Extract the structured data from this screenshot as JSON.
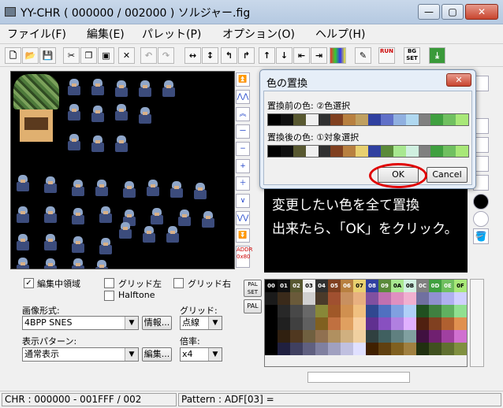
{
  "window": {
    "title": "YY-CHR ( 000000 / 002000 ) ソルジャー.fig",
    "min_glyph": "—",
    "max_glyph": "▢",
    "close_glyph": "✕"
  },
  "menu": [
    "ファイル(F)",
    "編集(E)",
    "パレット(P)",
    "オプション(O)",
    "ヘルプ(H)"
  ],
  "toolbar_icons": [
    "new-icon",
    "open-icon",
    "save-icon",
    "cut-icon",
    "copy-icon",
    "paste-icon",
    "delete-icon",
    "undo-icon",
    "redo-icon",
    "flip-horizontal-icon",
    "flip-vertical-icon",
    "rotate-left-icon",
    "rotate-right-icon",
    "shift-up-icon",
    "shift-down-icon",
    "shift-left-icon",
    "shift-right-icon",
    "palette-icon",
    "edit-icon",
    "run-icon",
    "bg-set-icon",
    "export-icon"
  ],
  "toolbar": {
    "run_label": "RUN",
    "bgset_label": "BG SET"
  },
  "side_buttons": [
    "⏫",
    "⋀⋀",
    "︽",
    "ー",
    "−",
    "+",
    "＋",
    "∨",
    "⋁⋁",
    "⏬"
  ],
  "addr_label": "ADDR 0x80",
  "dialog": {
    "title": "色の置換",
    "before_label": "置換前の色: ②色選択",
    "after_label": "置換後の色: ①対象選択",
    "ok": "OK",
    "cancel": "Cancel",
    "before_colors": [
      "#000000",
      "#101010",
      "#585830",
      "#f0f0f0",
      "#303030",
      "#804020",
      "#b88040",
      "#c0a060",
      "#3040a0",
      "#6070c8",
      "#90b0e0",
      "#b0d8f0",
      "#808080",
      "#40a040",
      "#70c060",
      "#a8e878"
    ],
    "after_colors": [
      "#000000",
      "#101010",
      "#585830",
      "#f0f0f0",
      "#303030",
      "#804020",
      "#b88040",
      "#e8d070",
      "#3040a0",
      "#5a8a3a",
      "#a8e890",
      "#d0f0e0",
      "#808080",
      "#40a040",
      "#70c060",
      "#a8e878"
    ]
  },
  "instruction": {
    "line1": "変更したい色を全て置換",
    "line2": "出来たら、「OK」をクリック。"
  },
  "palette_labels": {
    "pal_set": "PAL SET",
    "pal": "PAL"
  },
  "palette_header": [
    "00",
    "01",
    "02",
    "03",
    "04",
    "05",
    "06",
    "07",
    "08",
    "09",
    "0A",
    "0B",
    "0C",
    "0D",
    "0E",
    "0F"
  ],
  "palette_rows": [
    [
      "#000000",
      "#101010",
      "#585830",
      "#f0f0f0",
      "#303030",
      "#804020",
      "#b88040",
      "#e8d070",
      "#3040a0",
      "#5a8a3a",
      "#a8e890",
      "#d0f0e0",
      "#808080",
      "#40a040",
      "#70c060",
      "#a8e878"
    ],
    [
      "#1a1a1a",
      "#3a2a1a",
      "#6a5a3a",
      "#d0d0d0",
      "#4a3a2a",
      "#a05030",
      "#c89060",
      "#e8b080",
      "#8050a0",
      "#c070b0",
      "#e090c0",
      "#f0b0d0",
      "#7070a0",
      "#9090d0",
      "#b0b0f0",
      "#d0d0ff"
    ],
    [
      "#000000",
      "#282828",
      "#484848",
      "#686868",
      "#888838",
      "#a05828",
      "#d09050",
      "#f0c080",
      "#304890",
      "#5070c0",
      "#80a0e0",
      "#b0d0f8",
      "#205020",
      "#408040",
      "#60b060",
      "#90e090"
    ],
    [
      "#000000",
      "#202020",
      "#404040",
      "#606060",
      "#806020",
      "#c07040",
      "#e0a060",
      "#f8d0a0",
      "#603090",
      "#8850c0",
      "#b080e0",
      "#e0b0ff",
      "#502010",
      "#804020",
      "#b06030",
      "#e09050"
    ],
    [
      "#000000",
      "#302010",
      "#503820",
      "#706040",
      "#907050",
      "#b09060",
      "#d0b080",
      "#f0d0a0",
      "#304040",
      "#406060",
      "#608080",
      "#80a0a0",
      "#401040",
      "#702070",
      "#a040a0",
      "#d070d0"
    ],
    [
      "#000000",
      "#202040",
      "#404060",
      "#606080",
      "#8080a0",
      "#a0a0c0",
      "#c0c0e0",
      "#e0e0ff",
      "#402000",
      "#604010",
      "#806020",
      "#a08040",
      "#203010",
      "#405020",
      "#607030",
      "#809040"
    ]
  ],
  "controls": {
    "edit_area_label": "編集中領域",
    "edit_area_checked": true,
    "grid_left_label": "グリッド左",
    "grid_right_label": "グリッド右",
    "halftone_label": "Halftone",
    "image_format_label": "画像形式:",
    "image_format_value": "4BPP SNES",
    "info_button": "情報...",
    "grid_label": "グリッド:",
    "grid_value": "点線",
    "display_pattern_label": "表示パターン:",
    "display_pattern_value": "通常表示",
    "edit_button": "編集...",
    "zoom_label": "倍率:",
    "zoom_value": "x4"
  },
  "status": {
    "chr": "CHR : 000000 - 001FFF / 002",
    "pattern": "Pattern : ADF[03] ="
  }
}
